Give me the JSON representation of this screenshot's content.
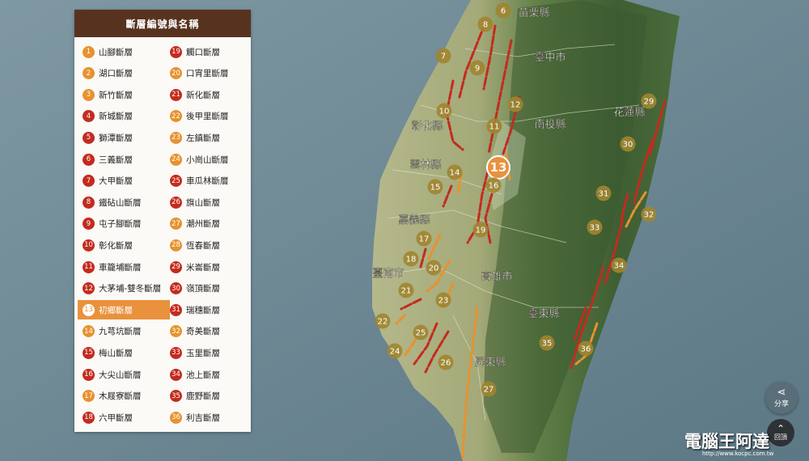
{
  "legend": {
    "title": "斷層編號與名稱",
    "items": [
      {
        "n": "1",
        "name": "山腳斷層",
        "color": "orange"
      },
      {
        "n": "2",
        "name": "湖口斷層",
        "color": "orange"
      },
      {
        "n": "3",
        "name": "新竹斷層",
        "color": "orange"
      },
      {
        "n": "4",
        "name": "新城斷層",
        "color": "red"
      },
      {
        "n": "5",
        "name": "獅潭斷層",
        "color": "red"
      },
      {
        "n": "6",
        "name": "三義斷層",
        "color": "red"
      },
      {
        "n": "7",
        "name": "大甲斷層",
        "color": "red"
      },
      {
        "n": "8",
        "name": "鐵砧山斷層",
        "color": "red"
      },
      {
        "n": "9",
        "name": "屯子腳斷層",
        "color": "red"
      },
      {
        "n": "10",
        "name": "彰化斷層",
        "color": "red"
      },
      {
        "n": "11",
        "name": "車籠埔斷層",
        "color": "red"
      },
      {
        "n": "12",
        "name": "大茅埔-雙冬斷層",
        "color": "red"
      },
      {
        "n": "13",
        "name": "初鄉斷層",
        "color": "orange",
        "active": true
      },
      {
        "n": "14",
        "name": "九芎坑斷層",
        "color": "orange"
      },
      {
        "n": "15",
        "name": "梅山斷層",
        "color": "red"
      },
      {
        "n": "16",
        "name": "大尖山斷層",
        "color": "red"
      },
      {
        "n": "17",
        "name": "木屐寮斷層",
        "color": "orange"
      },
      {
        "n": "18",
        "name": "六甲斷層",
        "color": "red"
      },
      {
        "n": "19",
        "name": "觸口斷層",
        "color": "red"
      },
      {
        "n": "20",
        "name": "口宵里斷層",
        "color": "orange"
      },
      {
        "n": "21",
        "name": "新化斷層",
        "color": "red"
      },
      {
        "n": "22",
        "name": "後甲里斷層",
        "color": "orange"
      },
      {
        "n": "23",
        "name": "左鎮斷層",
        "color": "orange"
      },
      {
        "n": "24",
        "name": "小崗山斷層",
        "color": "orange"
      },
      {
        "n": "25",
        "name": "車瓜林斷層",
        "color": "red"
      },
      {
        "n": "26",
        "name": "旗山斷層",
        "color": "red"
      },
      {
        "n": "27",
        "name": "潮州斷層",
        "color": "orange"
      },
      {
        "n": "28",
        "name": "恆春斷層",
        "color": "orange"
      },
      {
        "n": "29",
        "name": "米崙斷層",
        "color": "red"
      },
      {
        "n": "30",
        "name": "嶺頂斷層",
        "color": "red"
      },
      {
        "n": "31",
        "name": "瑞穗斷層",
        "color": "red"
      },
      {
        "n": "32",
        "name": "奇美斷層",
        "color": "orange"
      },
      {
        "n": "33",
        "name": "玉里斷層",
        "color": "red"
      },
      {
        "n": "34",
        "name": "池上斷層",
        "color": "red"
      },
      {
        "n": "35",
        "name": "鹿野斷層",
        "color": "red"
      },
      {
        "n": "36",
        "name": "利吉斷層",
        "color": "orange"
      }
    ]
  },
  "map": {
    "county_labels": [
      "苗栗縣",
      "臺中市",
      "南投縣",
      "彰化縣",
      "雲林縣",
      "花蓮縣",
      "嘉義縣",
      "臺南市",
      "高雄市",
      "臺東縣",
      "屏東縣"
    ],
    "markers": [
      "6",
      "8",
      "7",
      "9",
      "10",
      "12",
      "11",
      "13",
      "16",
      "14",
      "15",
      "19",
      "17",
      "18",
      "20",
      "21",
      "23",
      "22",
      "25",
      "24",
      "26",
      "27",
      "29",
      "30",
      "31",
      "32",
      "33",
      "34",
      "35",
      "36"
    ]
  },
  "controls": {
    "share_label": "分享",
    "back_label": "回頂"
  },
  "watermark": {
    "text": "電腦王阿達",
    "url": "http://www.kocpc.com.tw"
  },
  "colors": {
    "header": "#57331f",
    "active": "#e9913c",
    "fault_red": "#c32b1f",
    "fault_orange": "#e7922f",
    "marker": "#a08530"
  }
}
